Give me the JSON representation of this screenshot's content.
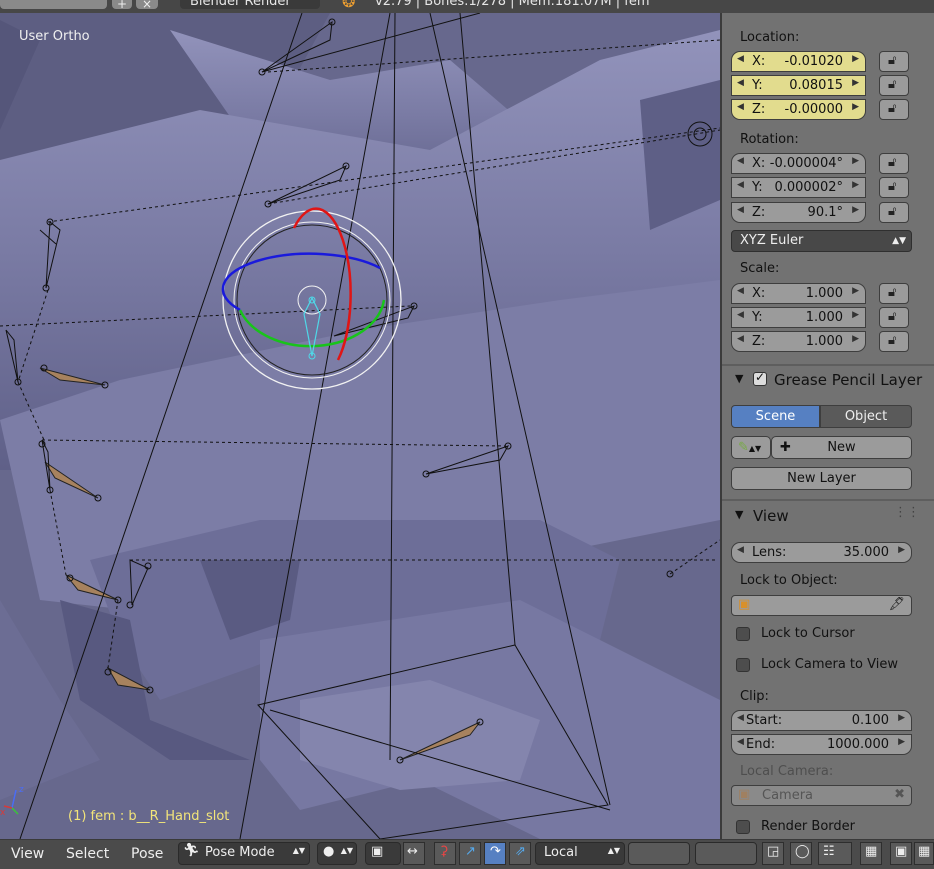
{
  "topbar": {
    "renderer": "Blender Render",
    "info": "v2.79 | Bones:1/278 | Mem:181.07M | fem"
  },
  "viewport": {
    "title": "User Ortho",
    "object_label": "(1) fem : b__R_Hand_slot"
  },
  "sidebar": {
    "location": {
      "label": "Location:",
      "x": "-0.01020",
      "y": "0.08015",
      "z": "-0.00000"
    },
    "rotation": {
      "label": "Rotation:",
      "x": "-0.000004°",
      "y": "0.000002°",
      "z": "90.1°"
    },
    "rotation_mode": "XYZ Euler",
    "scale": {
      "label": "Scale:",
      "x": "1.000",
      "y": "1.000",
      "z": "1.000"
    },
    "axis": {
      "x": "X:",
      "y": "Y:",
      "z": "Z:"
    },
    "grease_pencil": {
      "title": "Grease Pencil Layer",
      "scene": "Scene",
      "object": "Object",
      "new": "New",
      "new_layer": "New Layer"
    },
    "view": {
      "title": "View",
      "lens_label": "Lens:",
      "lens_value": "35.000",
      "lock_object_label": "Lock to Object:",
      "lock_cursor": "Lock to Cursor",
      "lock_camera": "Lock Camera to View",
      "clip_label": "Clip:",
      "start_label": "Start:",
      "start_value": "0.100",
      "end_label": "End:",
      "end_value": "1000.000",
      "local_camera_label": "Local Camera:",
      "camera_placeholder": "Camera",
      "render_border": "Render Border"
    }
  },
  "bottombar": {
    "view": "View",
    "select": "Select",
    "pose": "Pose",
    "mode": "Pose Mode",
    "orientation": "Local"
  },
  "colors": {
    "viewport": "#6f6f93",
    "accent": "#5680c2",
    "highlight": "#e2dc8e",
    "text_yellow": "#f3e57a"
  }
}
